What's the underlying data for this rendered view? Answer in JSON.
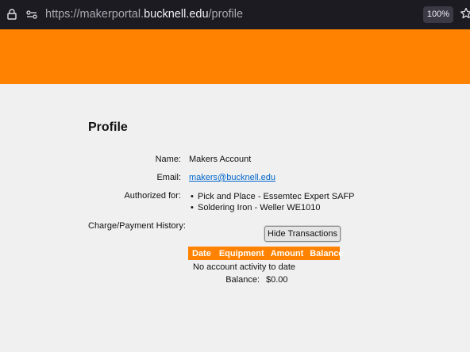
{
  "browser": {
    "url_prefix": "https://makerportal.",
    "url_host": "bucknell.edu",
    "url_path": "/profile",
    "zoom": "100%"
  },
  "profile": {
    "title": "Profile",
    "name_label": "Name:",
    "name_value": "Makers Account",
    "email_label": "Email:",
    "email_value": "makers@bucknell.edu",
    "authorized_label": "Authorized for:",
    "authorized_items": [
      "Pick and Place - Essemtec Expert SAFP",
      "Soldering Iron - Weller WE1010"
    ],
    "history_label": "Charge/Payment History:",
    "hide_button": "Hide Transactions",
    "table_headers": [
      "Date",
      "Equipment",
      "Amount",
      "Balance"
    ],
    "empty_message": "No account activity to date",
    "balance_label": "Balance:",
    "balance_value": "$0.00"
  },
  "colors": {
    "accent": "#ff8200",
    "browser_bar": "#1c1b22",
    "page_bg": "#f0f0f0",
    "link": "#0066cc"
  },
  "icons": [
    "lock-icon",
    "site-permissions-icon",
    "bookmark-star-icon"
  ]
}
